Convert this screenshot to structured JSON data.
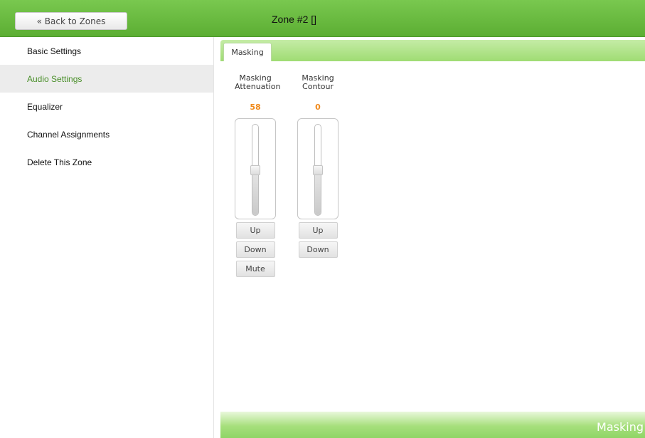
{
  "header": {
    "back_label": "« Back to Zones",
    "zone_title": "Zone #2 []"
  },
  "sidebar": {
    "items": [
      {
        "label": "Basic Settings",
        "active": false
      },
      {
        "label": "Audio Settings",
        "active": true
      },
      {
        "label": "Equalizer",
        "active": false
      },
      {
        "label": "Channel Assignments",
        "active": false
      },
      {
        "label": "Delete This Zone",
        "active": false
      }
    ]
  },
  "tabs": [
    {
      "label": "Masking",
      "selected": true
    }
  ],
  "controls": [
    {
      "label_line1": "Masking",
      "label_line2": "Attenuation",
      "value": "58",
      "slider_level": 0.5,
      "buttons": {
        "up": "Up",
        "down": "Down",
        "mute": "Mute"
      }
    },
    {
      "label_line1": "Masking",
      "label_line2": "Contour",
      "value": "0",
      "slider_level": 0.5,
      "buttons": {
        "up": "Up",
        "down": "Down"
      }
    }
  ],
  "footer": {
    "label": "Masking"
  },
  "colors": {
    "header_green": "#5cae33",
    "active_text": "#4a8f2a",
    "value_orange": "#f08a1c"
  }
}
